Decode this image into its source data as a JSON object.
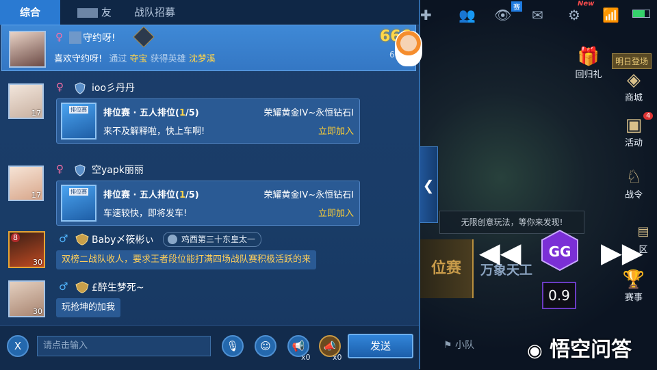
{
  "tabs": [
    {
      "label": "综合",
      "active": true
    },
    {
      "label": "友",
      "active": false
    },
    {
      "label": "战队招募",
      "active": false
    }
  ],
  "pinned": {
    "gender": "♀",
    "title_fragment": "守约呀!",
    "line": {
      "name": "喜欢守约呀!",
      "prefix": "通过",
      "source": "夺宝",
      "mid": "获得英雄",
      "hero": "沈梦溪"
    },
    "badge_number": "666",
    "badge_sub": "66"
  },
  "messages": [
    {
      "name": "ioo彡丹丹",
      "gender": "♀",
      "level": "17",
      "card": {
        "tag": "排位赛",
        "title": "排位赛 · 五人排位",
        "slots": "(1/5)",
        "slots_num": "1",
        "rank": "荣耀黄金IV~永恒钻石I",
        "note": "来不及解释啦，快上车啊!",
        "join": "立即加入"
      }
    },
    {
      "name": "空yapk丽丽",
      "gender": "♀",
      "level": "17",
      "card": {
        "tag": "排位赛",
        "title": "排位赛 · 五人排位",
        "slots": "(1/5)",
        "slots_num": "1",
        "rank": "荣耀黄金IV~永恒钻石I",
        "note": "车速较快，即将发车!",
        "join": "立即加入"
      }
    },
    {
      "name": "Baby〆筱彬ぃ",
      "gender": "♂",
      "level": "30",
      "vip": "8",
      "title_badge": "鸡西第三十东皇太一",
      "text": "双榜二战队收人，要求王者段位能打满四场战队赛积极活跃的来"
    },
    {
      "name": "£醉生梦死~",
      "gender": "♂",
      "level": "30",
      "text": "玩抢坤的加我"
    }
  ],
  "input": {
    "voice_label": "X",
    "placeholder": "请点击输入",
    "horn_count_1": "x0",
    "horn_count_2": "x0",
    "send_label": "发送"
  },
  "game_bg": {
    "new_badge": "New",
    "sai_badge": "赛",
    "tomorrow_login": "明日登场",
    "return_gift": "回归礼",
    "shop": "商城",
    "activity": "活动",
    "activity_badge": "4",
    "battle_pass": "战令",
    "zone": "区",
    "events": "赛事",
    "banner": "无限创意玩法，等你来发现!",
    "banner_highlight": "创意玩法",
    "mode_left": "位赛",
    "mode_center": "万象天工",
    "team": "小队"
  },
  "gg": {
    "value": "0.9"
  },
  "watermark": {
    "text": "悟空问答"
  }
}
